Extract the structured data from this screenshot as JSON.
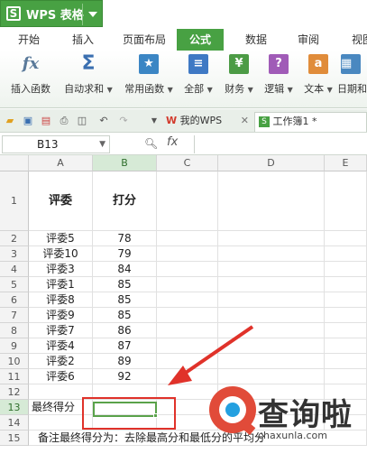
{
  "app": {
    "name": "WPS 表格",
    "logo": "S"
  },
  "tabs": [
    "开始",
    "插入",
    "页面布局",
    "公式",
    "数据",
    "审阅",
    "视图"
  ],
  "active_tab": "公式",
  "ribbon": [
    {
      "label": "插入函数",
      "icon": "fx-icon",
      "glyph": "fx",
      "color": "#6a8aa8"
    },
    {
      "label": "自动求和",
      "icon": "sigma-icon",
      "glyph": "Σ",
      "color": "#3a6fb0"
    },
    {
      "label": "常用函数",
      "icon": "star-icon",
      "glyph": "★",
      "color": "#3b86c4"
    },
    {
      "label": "全部",
      "icon": "list-icon",
      "glyph": "≡",
      "color": "#3f79c4"
    },
    {
      "label": "财务",
      "icon": "finance-icon",
      "glyph": "¥",
      "color": "#4c9b45"
    },
    {
      "label": "逻辑",
      "icon": "logic-icon",
      "glyph": "?",
      "color": "#a05bb7"
    },
    {
      "label": "文本",
      "icon": "text-icon",
      "glyph": "a",
      "color": "#e08c3a"
    },
    {
      "label": "日期和",
      "icon": "date-icon",
      "glyph": "▦",
      "color": "#4a88c0"
    }
  ],
  "doc_tabs": [
    {
      "label": "我的WPS",
      "logo": "W"
    },
    {
      "label": "工作簿1 *",
      "logo": "S"
    }
  ],
  "namebox": "B13",
  "formula_label": "fx",
  "columns": [
    "A",
    "B",
    "C",
    "D",
    "E"
  ],
  "header_row": {
    "judge": "评委",
    "score": "打分"
  },
  "rows": [
    {
      "num": "1"
    },
    {
      "num": "2",
      "judge": "评委5",
      "score": "78"
    },
    {
      "num": "3",
      "judge": "评委10",
      "score": "79"
    },
    {
      "num": "4",
      "judge": "评委3",
      "score": "84"
    },
    {
      "num": "5",
      "judge": "评委1",
      "score": "85"
    },
    {
      "num": "6",
      "judge": "评委8",
      "score": "85"
    },
    {
      "num": "7",
      "judge": "评委9",
      "score": "85"
    },
    {
      "num": "8",
      "judge": "评委7",
      "score": "86"
    },
    {
      "num": "9",
      "judge": "评委4",
      "score": "87"
    },
    {
      "num": "10",
      "judge": "评委2",
      "score": "89"
    },
    {
      "num": "11",
      "judge": "评委6",
      "score": "92"
    },
    {
      "num": "12"
    },
    {
      "num": "13",
      "judge": "最终得分"
    },
    {
      "num": "14"
    },
    {
      "num": "15",
      "judge": "备注最终得分为：去除最高分和最低分的平均分"
    }
  ],
  "watermark": {
    "text": "查询啦",
    "url": "chaxunla.com"
  },
  "colors": {
    "brand_green": "#48a143",
    "selection_green": "#5aa24a",
    "annotation_red": "#e0322a"
  }
}
